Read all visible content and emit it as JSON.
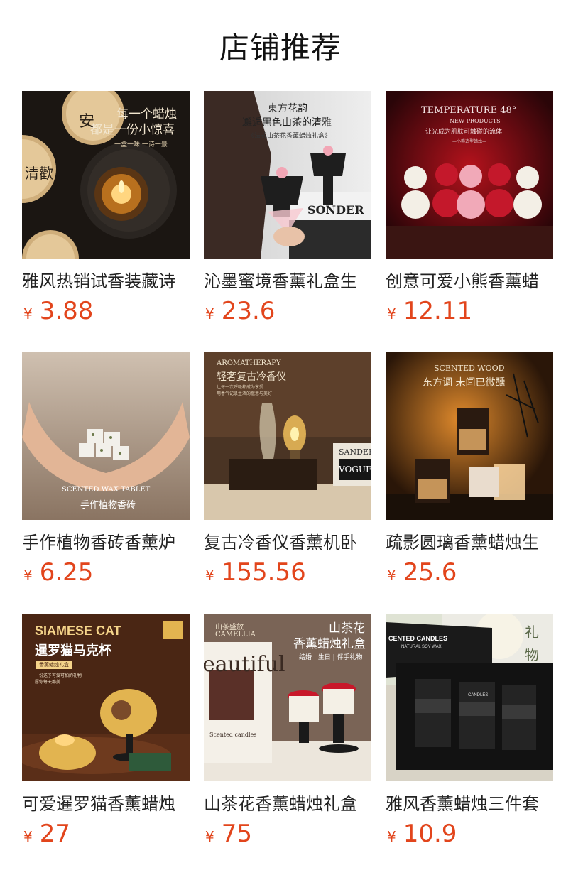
{
  "page_title": "店铺推荐",
  "currency": "¥",
  "colors": {
    "price": "#e2451c",
    "title": "#111111",
    "background": "#ffffff"
  },
  "products": [
    {
      "name": "雅风热销试香装藏诗",
      "price": "3.88",
      "thumb_text": [
        "每一个蜡烛",
        "都是一份小惊喜",
        "一盒一味 一诗一景",
        "安",
        "清歡"
      ]
    },
    {
      "name": "沁墨蜜境香薰礼盒生",
      "price": "23.6",
      "thumb_text": [
        "東方花韵",
        "邂逅黑色山茶的清雅",
        "《法式山茶花香薰蜡烛礼盒》",
        "SONDER"
      ]
    },
    {
      "name": "创意可爱小熊香薰蜡",
      "price": "12.11",
      "thumb_text": [
        "TEMPERATURE 48°",
        "NEW PRODUCTS",
        "让光成为肌肤可触碰的流体",
        "—小熊造型蜡烛—"
      ]
    },
    {
      "name": "手作植物香砖香薰炉",
      "price": "6.25",
      "thumb_text": [
        "SCENTED WAX TABLET",
        "手作植物香砖"
      ]
    },
    {
      "name": "复古冷香仪香薰机卧",
      "price": "155.56",
      "thumb_text": [
        "AROMATHERAPY",
        "轻奢复古冷香仪",
        "让每一次呼吸都成为享受",
        "用香气记录生活的惬意与美好",
        "VOGUE",
        "SANDER"
      ]
    },
    {
      "name": "疏影圆璃香薰蜡烛生",
      "price": "25.6",
      "thumb_text": [
        "SCENTED WOOD",
        "东方调 未闻已微醺"
      ]
    },
    {
      "name": "可爱暹罗猫香薰蜡烛",
      "price": "27",
      "thumb_text": [
        "SIAMESE CAT",
        "暹罗猫马克杯",
        "香薰蜡烛礼盒",
        "一份送予可爱可拍的礼物",
        "愿你每天都美"
      ]
    },
    {
      "name": "山茶花香薰蜡烛礼盒",
      "price": "75",
      "thumb_text": [
        "山茶盛放",
        "CAMELLIA",
        "山茶花",
        "香薰蜡烛礼盒",
        "结婚 | 生日 | 伴手礼物",
        "eautiful",
        "Scented candles"
      ]
    },
    {
      "name": "雅风香薰蜡烛三件套",
      "price": "10.9",
      "thumb_text": [
        "礼",
        "物",
        "CENTED CANDLES",
        "NATURAL SOY WAX",
        "CANDLES"
      ]
    }
  ]
}
